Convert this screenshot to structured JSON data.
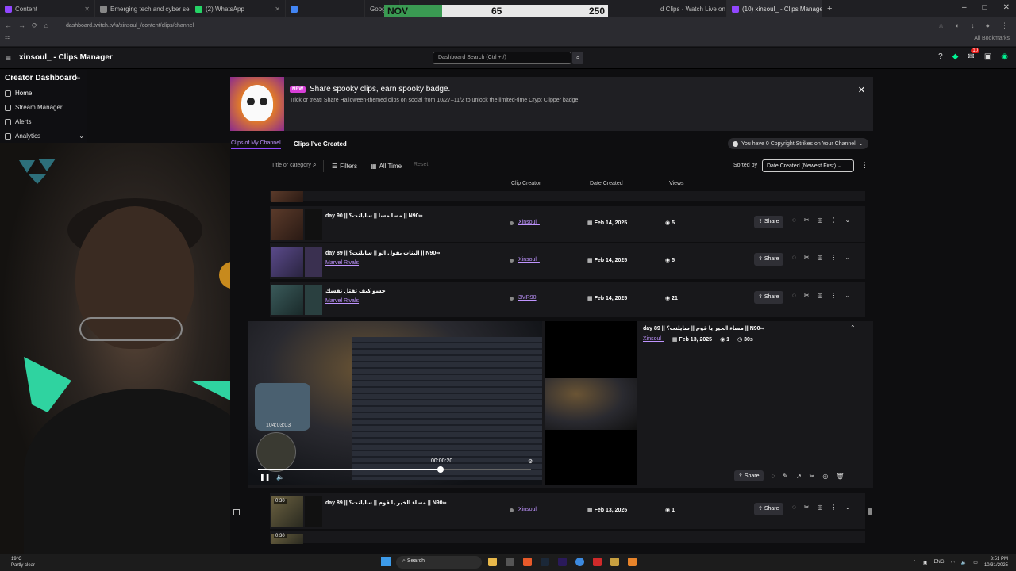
{
  "browser": {
    "tabs": [
      {
        "label": "Content",
        "icon": "twitch-icon"
      },
      {
        "label": "Emerging tech and cyber sec...",
        "icon": "globe-icon"
      },
      {
        "label": "(2) WhatsApp",
        "icon": "whatsapp-icon"
      },
      {
        "label": "",
        "icon": "doc-icon"
      },
      {
        "label": "Google ...",
        "icon": "google-icon"
      },
      {
        "label": "d Clips · Watch Live on ...",
        "icon": "twitch-icon"
      },
      {
        "label": "(10) xinsoul_ - Clips Manager",
        "icon": "twitch-icon"
      }
    ],
    "url": "dashboard.twitch.tv/u/xinsoul_/content/clips/channel",
    "bookmarks_left": "☷",
    "bookmarks_right": "All Bookmarks"
  },
  "stream_overlay": {
    "month": "NOV",
    "value1": "65",
    "value2": "250"
  },
  "topnav": {
    "title": "xinsoul_ - Clips Manager",
    "search_placeholder": "Dashboard Search (Ctrl + /)",
    "notification_count": "10"
  },
  "sidebar": {
    "heading": "Creator Dashboard",
    "items": [
      {
        "label": "Home",
        "icon": "home-icon"
      },
      {
        "label": "Stream Manager",
        "icon": "stream-icon"
      },
      {
        "label": "Alerts",
        "icon": "bell-icon"
      },
      {
        "label": "Analytics",
        "icon": "chart-icon"
      }
    ]
  },
  "banner": {
    "badge": "NEW",
    "title": "Share spooky clips, earn spooky badge.",
    "description": "Trick or treat! Share Halloween-themed clips on social from 10/27–11/2 to unlock the limited-time Crypt Clipper badge."
  },
  "content_tabs": {
    "tab1": "Clips of My Channel",
    "tab2": "Clips I've Created"
  },
  "copyright": "You have 0 Copyright Strikes on Your Channel",
  "filters": {
    "search_placeholder": "Title or category",
    "filters_label": "Filters",
    "time_label": "All Time",
    "reset_label": "Reset",
    "sorted_by_label": "Sorted by",
    "sort_value": "Date Created (Newest First)"
  },
  "columns": {
    "creator": "Clip Creator",
    "date": "Date Created",
    "views": "Views"
  },
  "rows": [
    {
      "title": "day 90 || مسا مسا || سايلنت؟ || N90∞",
      "game": "",
      "creator": "Xinsoul_",
      "date": "Feb 14, 2025",
      "views": "5"
    },
    {
      "title": "day 89 || البنات يقول الو || سايلنت؟ || N90∞",
      "game": "Marvel Rivals",
      "creator": "Xinsoul_",
      "date": "Feb 14, 2025",
      "views": "5"
    },
    {
      "title": "جسو كيف تقتل نفسك",
      "game": "Marvel Rivals",
      "creator": "3MR90",
      "date": "Feb 14, 2025",
      "views": "21"
    },
    {
      "title": "day 89 || مساء الخير يا قوم || سايلنت؟ || N90∞",
      "game": "",
      "creator": "Xinsoul_",
      "date": "Feb 13, 2025",
      "views": "1",
      "duration": "0:30"
    }
  ],
  "expanded": {
    "title": "day 89 || مساء الخير يا قوم || سايلنت؟ || N90∞",
    "creator": "Xinsoul_",
    "date": "Feb 13, 2025",
    "views": "1",
    "length": "30s",
    "timecode": "00:00:20",
    "video_hud": "104:03:03",
    "progress_fraction": 0.67
  },
  "share_label": "Share",
  "last_row_duration": "0:30",
  "taskbar": {
    "weather_temp": "19°C",
    "weather_desc": "Partly clear",
    "search_label": "Search",
    "lang": "ENG",
    "time": "3:51 PM",
    "date": "10/31/2025"
  },
  "colors": {
    "accent": "#9147ff",
    "link": "#bf94ff",
    "bg": "#0e0e10",
    "surface": "#18181b"
  }
}
